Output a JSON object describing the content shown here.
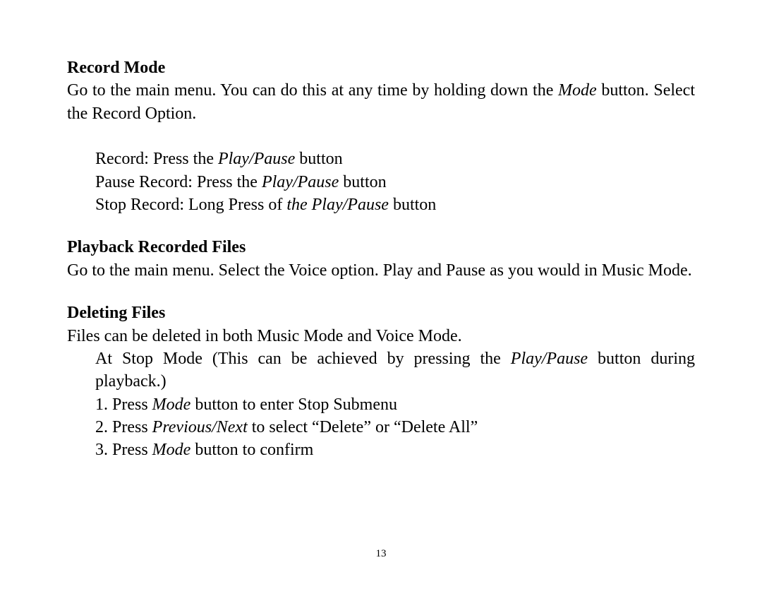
{
  "section1": {
    "heading": "Record Mode",
    "p1a": "Go to the main menu. You can do this at any time by holding down the ",
    "p1_em": "Mode",
    "p1b": " button. Select the Record Option.",
    "rec_a": "Record: Press the ",
    "rec_em": "Play/Pause",
    "rec_b": " button",
    "pause_a": "Pause Record: Press the ",
    "pause_em": "Play/Pause",
    "pause_b": " button",
    "stop_a": "Stop Record: Long Press of ",
    "stop_em": "the Play/Pause",
    "stop_b": " button"
  },
  "section2": {
    "heading": "Playback Recorded Files",
    "p1": "Go to the main menu. Select the Voice option. Play and Pause as you would in Music Mode."
  },
  "section3": {
    "heading": "Deleting Files",
    "p1": "Files can be deleted in both Music Mode and Voice Mode.",
    "sub_a": "At Stop Mode (This can be achieved by pressing the ",
    "sub_em": "Play/Pause",
    "sub_b": " button during playback.)",
    "step1_a": "1. Press ",
    "step1_em": "Mode",
    "step1_b": " button to enter Stop Submenu",
    "step2_a": "2. Press ",
    "step2_em": "Previous/Next",
    "step2_b": " to select “Delete” or “Delete All”",
    "step3_a": "3. Press ",
    "step3_em": "Mode",
    "step3_b": " button to confirm"
  },
  "page_number": "13"
}
